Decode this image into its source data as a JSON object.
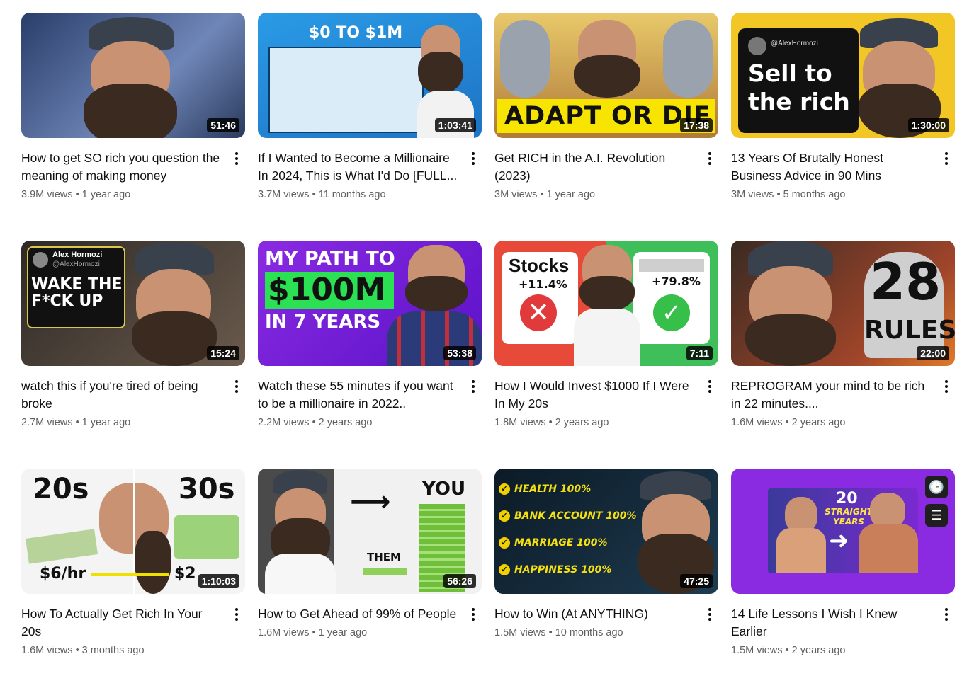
{
  "videos": [
    {
      "title": "How to get SO rich you question the meaning of making money",
      "views": "3.9M views",
      "age": "1 year ago",
      "duration": "51:46",
      "bg": "#3b4f7a"
    },
    {
      "title": "If I Wanted to Become a Millionaire In 2024, This is What I'd Do [FULL...",
      "views": "3.7M views",
      "age": "11 months ago",
      "duration": "1:03:41",
      "bg": "#1e90d8",
      "overlay": "$0 TO $1M"
    },
    {
      "title": "Get RICH in the A.I. Revolution (2023)",
      "views": "3M views",
      "age": "1 year ago",
      "duration": "17:38",
      "bg": "#caa24a",
      "overlay": "ADAPT OR DIE"
    },
    {
      "title": "13 Years Of Brutally Honest Business Advice in 90 Mins",
      "views": "3M views",
      "age": "5 months ago",
      "duration": "1:30:00",
      "bg": "#f2c624",
      "overlay": "Sell to the rich",
      "handle": "@AlexHormozi"
    },
    {
      "title": "watch this if you're tired of being broke",
      "views": "2.7M views",
      "age": "1 year ago",
      "duration": "15:24",
      "bg": "#4a4038",
      "overlay": "WAKE THE F*CK UP",
      "handle_name": "Alex Hormozi",
      "handle": "@AlexHormozi"
    },
    {
      "title": "Watch these 55 minutes if you want to be a millionaire in 2022..",
      "views": "2.2M views",
      "age": "2 years ago",
      "duration": "53:38",
      "bg": "#7b22e0",
      "overlay_1": "MY PATH TO",
      "overlay_2": "$100M",
      "overlay_3": "IN 7 YEARS"
    },
    {
      "title": "How I Would Invest $1000 If I Were In My 20s",
      "views": "1.8M views",
      "age": "2 years ago",
      "duration": "7:11",
      "bg": "#e23a3a",
      "overlay_1": "Stocks",
      "overlay_2": "+11.4%",
      "overlay_3": "+79.8%"
    },
    {
      "title": "REPROGRAM your mind to be rich in 22 minutes....",
      "views": "1.6M views",
      "age": "2 years ago",
      "duration": "22:00",
      "bg": "#7a3b1e",
      "overlay_1": "28",
      "overlay_2": "RULES"
    },
    {
      "title": "How To Actually Get Rich In Your 20s",
      "views": "1.6M views",
      "age": "3 months ago",
      "duration": "1:10:03",
      "bg": "#f4f4f4",
      "overlay_1": "20s",
      "overlay_2": "30s",
      "overlay_3": "$6/hr",
      "overlay_4": "$2"
    },
    {
      "title": "How to Get Ahead of 99% of People",
      "views": "1.6M views",
      "age": "1 year ago",
      "duration": "56:26",
      "bg": "#e9e9e9",
      "overlay_1": "YOU",
      "overlay_2": "THEM"
    },
    {
      "title": "How to Win (At ANYTHING)",
      "views": "1.5M views",
      "age": "10 months ago",
      "duration": "47:25",
      "bg": "#152a3a",
      "items": [
        "HEALTH 100%",
        "BANK ACCOUNT 100%",
        "MARRIAGE 100%",
        "HAPPINESS 100%"
      ]
    },
    {
      "title": "14 Life Lessons I Wish I Knew Earlier",
      "views": "1.5M views",
      "age": "2 years ago",
      "duration": "",
      "bg": "#8a2be2",
      "overlay_1": "20",
      "overlay_2": "STRAIGHT YEARS"
    }
  ],
  "separator": "•",
  "icons": {
    "more": "more-vert-icon",
    "watch_later": "clock-icon",
    "add_queue": "playlist-add-icon"
  }
}
